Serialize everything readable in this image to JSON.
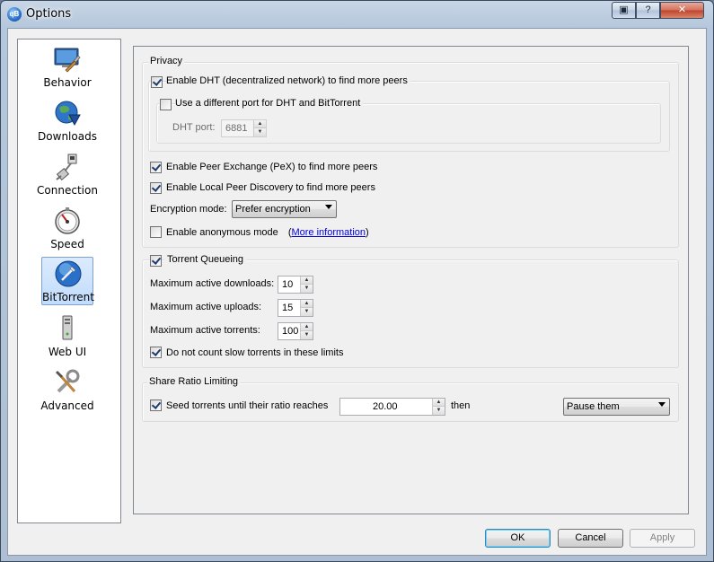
{
  "window": {
    "title": "Options",
    "app_icon_text": "qB",
    "restore_glyph": "▣",
    "help_glyph": "?",
    "close_glyph": "✕"
  },
  "sidebar": {
    "items": [
      {
        "label": "Behavior",
        "icon": "behavior-icon",
        "selected": false
      },
      {
        "label": "Downloads",
        "icon": "downloads-icon",
        "selected": false
      },
      {
        "label": "Connection",
        "icon": "connection-icon",
        "selected": false
      },
      {
        "label": "Speed",
        "icon": "speed-icon",
        "selected": false
      },
      {
        "label": "BitTorrent",
        "icon": "bittorrent-icon",
        "selected": true
      },
      {
        "label": "Web UI",
        "icon": "webui-icon",
        "selected": false
      },
      {
        "label": "Advanced",
        "icon": "advanced-icon",
        "selected": false
      }
    ]
  },
  "privacy": {
    "title": "Privacy",
    "dht": {
      "label": "Enable DHT (decentralized network) to find more peers",
      "checked": true
    },
    "diff_port": {
      "label": "Use a different port for DHT and BitTorrent",
      "checked": false
    },
    "dht_port": {
      "label": "DHT port:",
      "value": "6881",
      "enabled": false
    },
    "pex": {
      "label": "Enable Peer Exchange (PeX) to find more peers",
      "checked": true
    },
    "lpd": {
      "label": "Enable Local Peer Discovery to find more peers",
      "checked": true
    },
    "encryption": {
      "label": "Encryption mode:",
      "value": "Prefer encryption"
    },
    "anonymous": {
      "label": "Enable anonymous mode",
      "paren_open": "(",
      "link": "More information",
      "paren_close": ")",
      "checked": false
    }
  },
  "queueing": {
    "title": "Torrent Queueing",
    "checked": true,
    "max_downloads": {
      "label": "Maximum active downloads:",
      "value": "10"
    },
    "max_uploads": {
      "label": "Maximum active uploads:",
      "value": "15"
    },
    "max_torrents": {
      "label": "Maximum active torrents:",
      "value": "100"
    },
    "slow": {
      "label": "Do not count slow torrents in these limits",
      "checked": true
    }
  },
  "share_ratio": {
    "title": "Share Ratio Limiting",
    "seed": {
      "label": "Seed torrents until their ratio reaches",
      "checked": true
    },
    "ratio_value": "20.00",
    "then_label": "then",
    "action": "Pause them"
  },
  "buttons": {
    "ok": "OK",
    "cancel": "Cancel",
    "apply": "Apply"
  },
  "spin_up": "▲",
  "spin_down": "▼"
}
